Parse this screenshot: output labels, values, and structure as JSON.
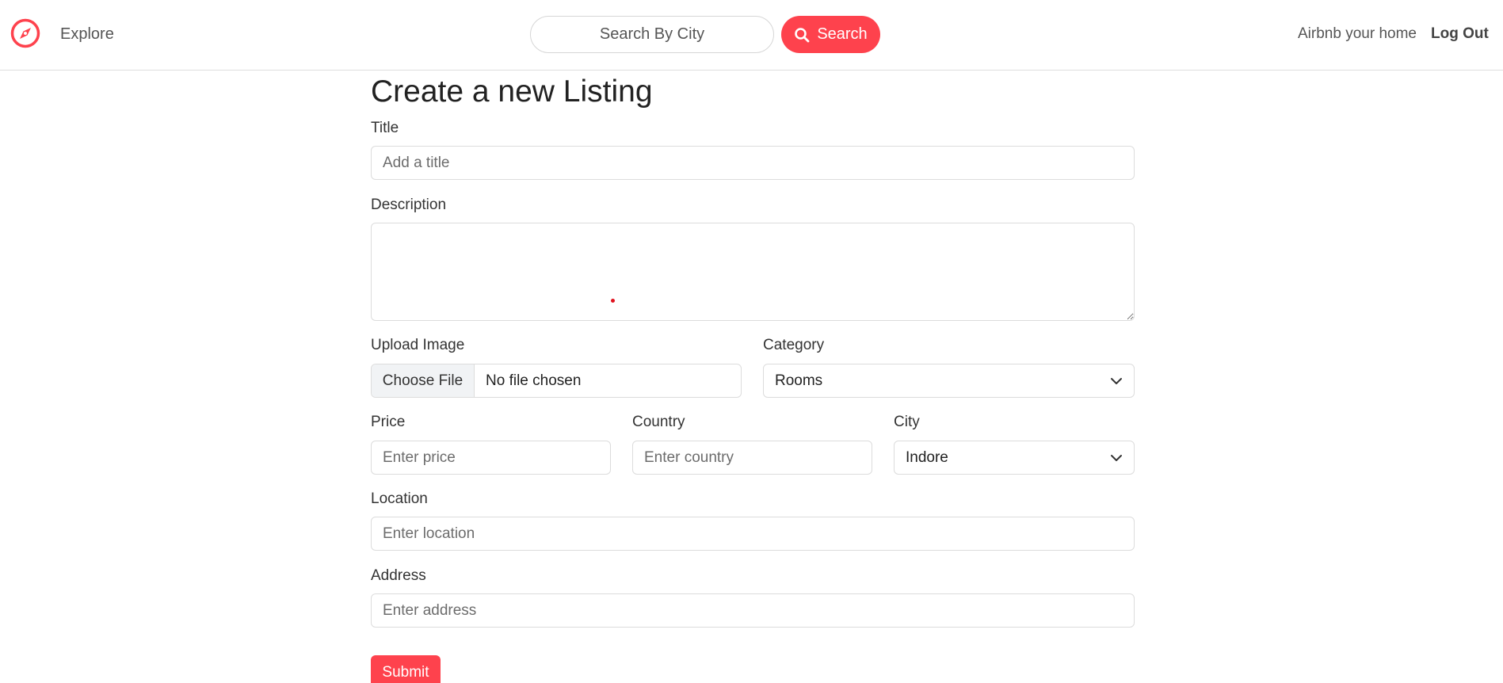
{
  "navbar": {
    "brand_icon": "compass-icon",
    "brand_color": "#fe424d",
    "explore_label": "Explore",
    "search_placeholder": "Search By City",
    "search_button_label": "Search",
    "search_button_color": "#fe424d",
    "host_label": "Airbnb your home",
    "logout_label": "Log Out"
  },
  "form": {
    "heading": "Create a new Listing",
    "title": {
      "label": "Title",
      "placeholder": "Add a title",
      "value": ""
    },
    "description": {
      "label": "Description",
      "value": ""
    },
    "upload_image": {
      "label": "Upload Image",
      "button_label": "Choose File",
      "status": "No file chosen"
    },
    "category": {
      "label": "Category",
      "selected": "Rooms"
    },
    "price": {
      "label": "Price",
      "placeholder": "Enter price",
      "value": ""
    },
    "country": {
      "label": "Country",
      "placeholder": "Enter country",
      "value": ""
    },
    "city": {
      "label": "City",
      "selected": "Indore"
    },
    "location": {
      "label": "Location",
      "placeholder": "Enter location",
      "value": ""
    },
    "address": {
      "label": "Address",
      "placeholder": "Enter address",
      "value": ""
    },
    "submit_label": "Submit",
    "submit_color": "#fe424d"
  }
}
